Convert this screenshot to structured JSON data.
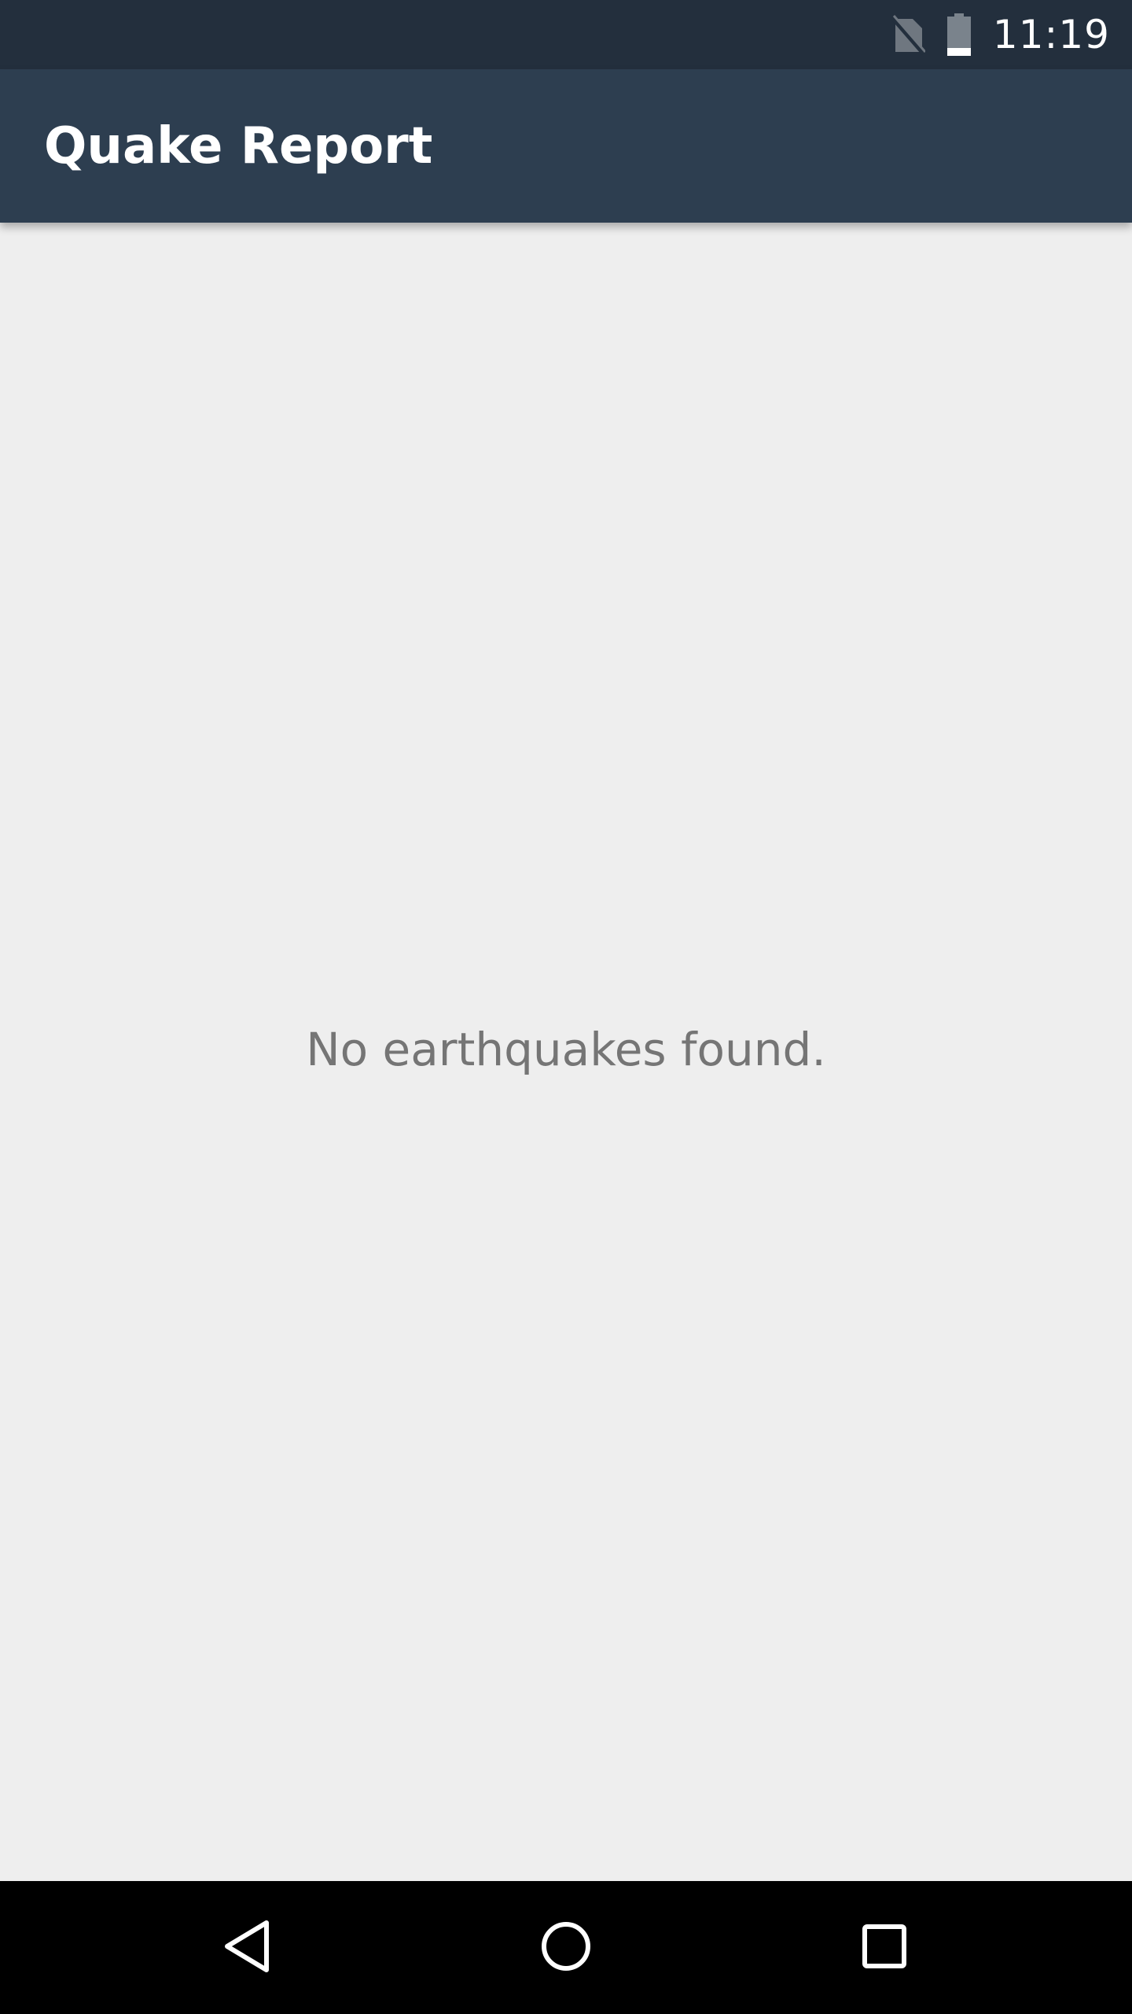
{
  "status_bar": {
    "time": "11:19",
    "icons": [
      "no-sim-icon",
      "battery-icon"
    ]
  },
  "app_bar": {
    "title": "Quake Report"
  },
  "main": {
    "empty_message": "No earthquakes found."
  },
  "nav_bar": {
    "buttons": [
      "back-icon",
      "home-icon",
      "recents-icon"
    ]
  },
  "colors": {
    "status_bar_bg": "#232F3D",
    "app_bar_bg": "#2D3E50",
    "content_bg": "#EEEEEE",
    "empty_text": "#757575",
    "nav_bar_bg": "#000000"
  }
}
